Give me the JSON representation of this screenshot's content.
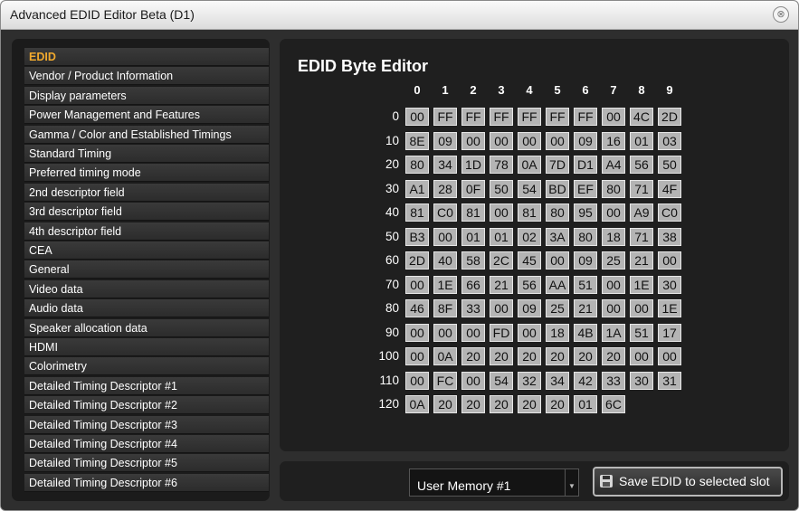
{
  "window": {
    "title": "Advanced EDID Editor Beta (D1)",
    "close_glyph": "⊗"
  },
  "sidebar": {
    "items": [
      "EDID",
      "Vendor / Product Information",
      "Display parameters",
      "Power Management and Features",
      "Gamma / Color and Established Timings",
      "Standard Timing",
      "Preferred timing mode",
      "2nd descriptor field",
      "3rd descriptor field",
      "4th descriptor field",
      "CEA",
      "General",
      "Video data",
      "Audio data",
      "Speaker allocation data",
      "HDMI",
      "Colorimetry",
      "Detailed Timing Descriptor #1",
      "Detailed Timing Descriptor #2",
      "Detailed Timing Descriptor #3",
      "Detailed Timing Descriptor #4",
      "Detailed Timing Descriptor #5",
      "Detailed Timing Descriptor #6"
    ],
    "active_index": 0,
    "active_color": "#f0a92e"
  },
  "editor": {
    "title": "EDID Byte Editor",
    "col_headers": [
      "0",
      "1",
      "2",
      "3",
      "4",
      "5",
      "6",
      "7",
      "8",
      "9"
    ],
    "rows": [
      {
        "label": "0",
        "bytes": [
          "00",
          "FF",
          "FF",
          "FF",
          "FF",
          "FF",
          "FF",
          "00",
          "4C",
          "2D"
        ]
      },
      {
        "label": "10",
        "bytes": [
          "8E",
          "09",
          "00",
          "00",
          "00",
          "00",
          "09",
          "16",
          "01",
          "03"
        ]
      },
      {
        "label": "20",
        "bytes": [
          "80",
          "34",
          "1D",
          "78",
          "0A",
          "7D",
          "D1",
          "A4",
          "56",
          "50"
        ]
      },
      {
        "label": "30",
        "bytes": [
          "A1",
          "28",
          "0F",
          "50",
          "54",
          "BD",
          "EF",
          "80",
          "71",
          "4F"
        ]
      },
      {
        "label": "40",
        "bytes": [
          "81",
          "C0",
          "81",
          "00",
          "81",
          "80",
          "95",
          "00",
          "A9",
          "C0"
        ]
      },
      {
        "label": "50",
        "bytes": [
          "B3",
          "00",
          "01",
          "01",
          "02",
          "3A",
          "80",
          "18",
          "71",
          "38"
        ]
      },
      {
        "label": "60",
        "bytes": [
          "2D",
          "40",
          "58",
          "2C",
          "45",
          "00",
          "09",
          "25",
          "21",
          "00"
        ]
      },
      {
        "label": "70",
        "bytes": [
          "00",
          "1E",
          "66",
          "21",
          "56",
          "AA",
          "51",
          "00",
          "1E",
          "30"
        ]
      },
      {
        "label": "80",
        "bytes": [
          "46",
          "8F",
          "33",
          "00",
          "09",
          "25",
          "21",
          "00",
          "00",
          "1E"
        ]
      },
      {
        "label": "90",
        "bytes": [
          "00",
          "00",
          "00",
          "FD",
          "00",
          "18",
          "4B",
          "1A",
          "51",
          "17"
        ]
      },
      {
        "label": "100",
        "bytes": [
          "00",
          "0A",
          "20",
          "20",
          "20",
          "20",
          "20",
          "20",
          "00",
          "00"
        ]
      },
      {
        "label": "110",
        "bytes": [
          "00",
          "FC",
          "00",
          "54",
          "32",
          "34",
          "42",
          "33",
          "30",
          "31"
        ]
      },
      {
        "label": "120",
        "bytes": [
          "0A",
          "20",
          "20",
          "20",
          "20",
          "20",
          "01",
          "6C"
        ]
      }
    ]
  },
  "footer": {
    "memory_select": {
      "value": "User Memory #1",
      "arrow_glyph": "▼"
    },
    "save_button": {
      "label": "Save EDID to selected slot",
      "icon": "floppy-disk-icon"
    }
  }
}
